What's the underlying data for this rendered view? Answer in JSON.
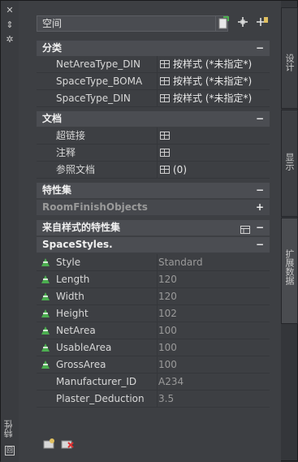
{
  "window": {
    "title": "特性",
    "close_glyph": "✕",
    "pin_glyph": "⇕",
    "settings_glyph": "✲",
    "bottom_glyph": "回"
  },
  "toolbar": {
    "style_value": "空间",
    "icons": [
      "select-objects-icon",
      "quick-select-icon",
      "toggle-pickadd-icon"
    ]
  },
  "sections": {
    "classification": {
      "title": "分类",
      "toggle": "−",
      "rows": [
        {
          "name": "NetAreaType_DIN",
          "value": "按样式 (*未指定*)"
        },
        {
          "name": "SpaceType_BOMA",
          "value": "按样式 (*未指定*)"
        },
        {
          "name": "SpaceType_DIN",
          "value": "按样式 (*未指定*)"
        }
      ]
    },
    "documents": {
      "title": "文档",
      "toggle": "−",
      "rows": [
        {
          "name": "超链接",
          "value": ""
        },
        {
          "name": "注释",
          "value": ""
        },
        {
          "name": "参照文档",
          "value": "(0)"
        }
      ]
    },
    "property_sets": {
      "title": "特性集",
      "toggle": "−",
      "sub": {
        "title": "RoomFinishObjects",
        "toggle": "+"
      }
    },
    "style_property_sets": {
      "title": "来自样式的特性集",
      "toggle": "−",
      "sub": {
        "title": "SpaceStyles.",
        "toggle": "−"
      },
      "rows": [
        {
          "name": "Style",
          "value": "Standard",
          "flag": true
        },
        {
          "name": "Length",
          "value": "120",
          "flag": true
        },
        {
          "name": "Width",
          "value": "120",
          "flag": true
        },
        {
          "name": "Height",
          "value": "102",
          "flag": true
        },
        {
          "name": "NetArea",
          "value": "100",
          "flag": true
        },
        {
          "name": "UsableArea",
          "value": "100",
          "flag": true
        },
        {
          "name": "GrossArea",
          "value": "100",
          "flag": true
        },
        {
          "name": "Manufacturer_ID",
          "value": "A234",
          "flag": false
        },
        {
          "name": "Plaster_Deduction",
          "value": "3.5",
          "flag": false
        }
      ]
    }
  },
  "tabs": [
    {
      "label": "设计"
    },
    {
      "label": "显示"
    },
    {
      "label": "扩展数据"
    }
  ],
  "colors": {
    "accent_green": "#4caf50",
    "tab_active": "#4a4c50"
  }
}
